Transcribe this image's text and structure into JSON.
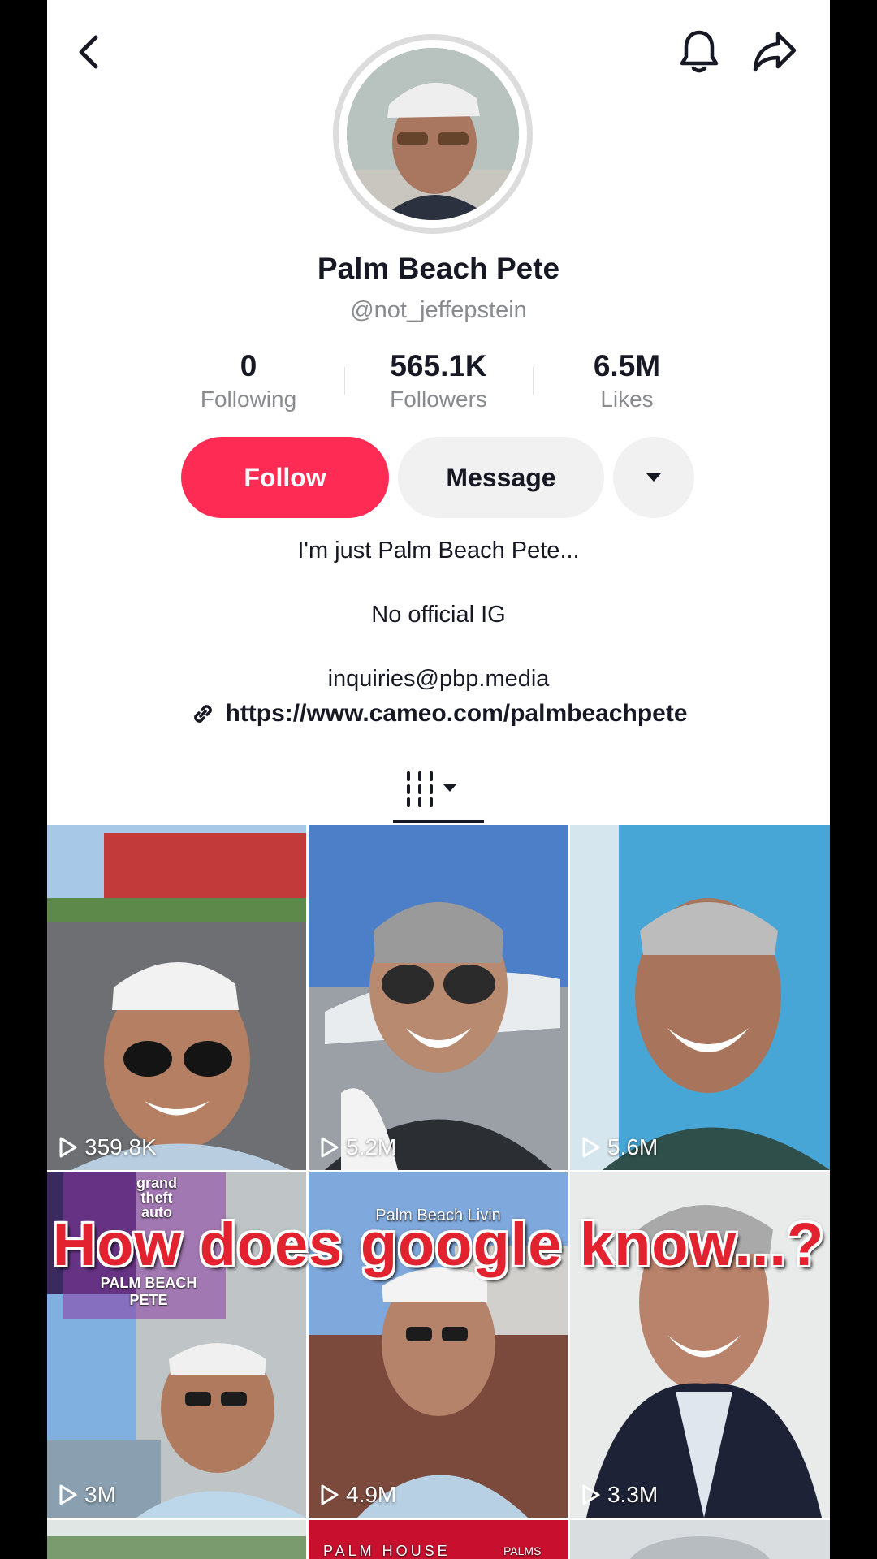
{
  "header": {
    "back_icon": "chevron-left-icon",
    "bell_icon": "bell-icon",
    "share_icon": "share-arrow-icon"
  },
  "profile": {
    "display_name": "Palm Beach Pete",
    "username": "@not_jeffepstein",
    "stats": [
      {
        "value": "0",
        "label": "Following"
      },
      {
        "value": "565.1K",
        "label": "Followers"
      },
      {
        "value": "6.5M",
        "label": "Likes"
      }
    ],
    "follow_label": "Follow",
    "message_label": "Message",
    "more_icon": "caret-down-icon",
    "bio_lines": [
      "I'm just Palm Beach Pete...",
      "No official IG",
      "inquiries@pbp.media"
    ],
    "link": "https://www.cameo.com/palmbeachpete",
    "link_icon": "link-icon"
  },
  "tabs": {
    "active_icon": "videos-grid-icon"
  },
  "videos": [
    {
      "views": "359.8K"
    },
    {
      "views": "5.2M"
    },
    {
      "views": "5.6M"
    },
    {
      "views": "3M",
      "thumb_text": [
        "grand theft auto",
        "PALM BEACH PETE"
      ]
    },
    {
      "views": "4.9M",
      "thumb_text": [
        "Palm Beach Livin"
      ]
    },
    {
      "views": "3.3M"
    }
  ],
  "next_row_thumb_text": [
    "PALM HOUSE",
    "PALMS"
  ],
  "overlay_caption": "How does google know...?",
  "colors": {
    "accent": "#fe2c55",
    "caption": "#e3222f",
    "muted_text": "#8a8b91",
    "primary_text": "#161823"
  }
}
